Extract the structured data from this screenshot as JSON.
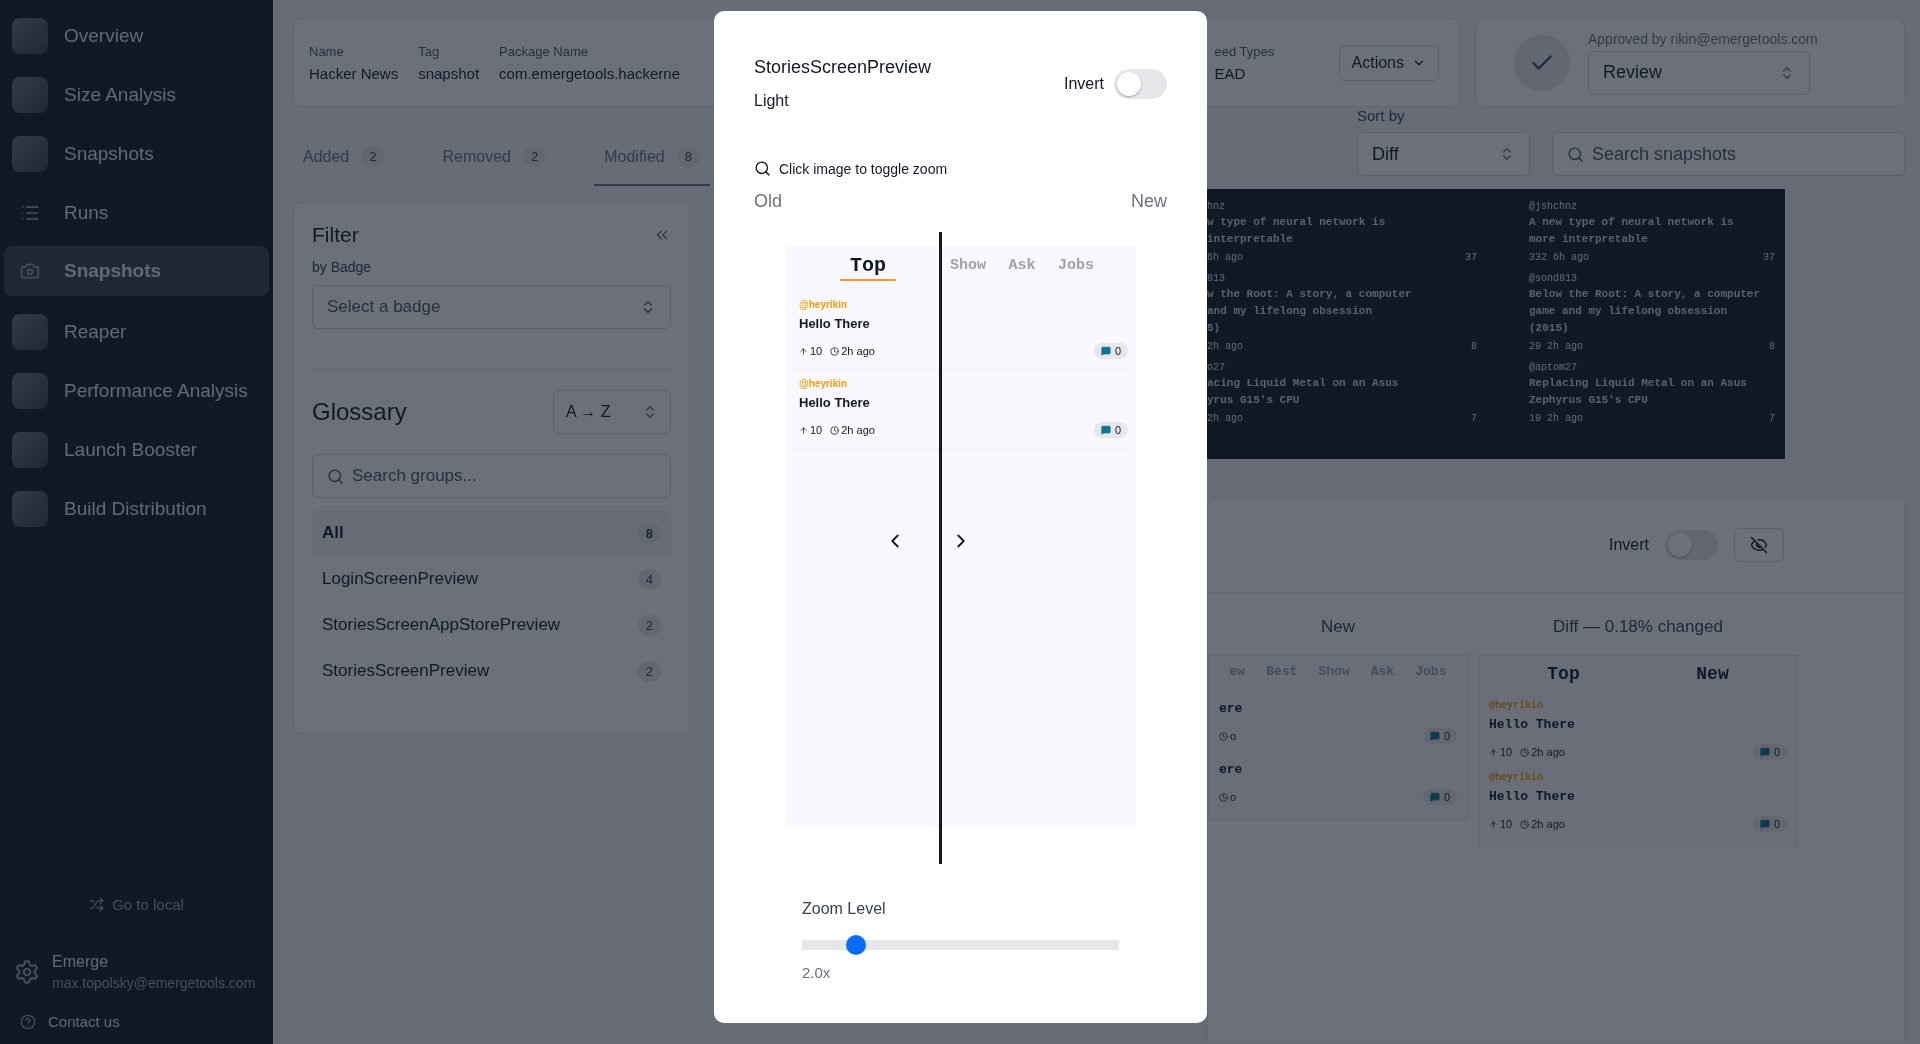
{
  "sidebar": {
    "items": [
      {
        "label": "Overview",
        "kind": "app",
        "selected": false
      },
      {
        "label": "Size Analysis",
        "kind": "app",
        "selected": false
      },
      {
        "label": "Snapshots",
        "kind": "app",
        "selected": false
      },
      {
        "label": "Runs",
        "kind": "list",
        "selected": false
      },
      {
        "label": "Snapshots",
        "kind": "camera",
        "selected": true
      },
      {
        "label": "Reaper",
        "kind": "app",
        "selected": false
      },
      {
        "label": "Performance Analysis",
        "kind": "app",
        "selected": false
      },
      {
        "label": "Launch Booster",
        "kind": "app",
        "selected": false
      },
      {
        "label": "Build Distribution",
        "kind": "app",
        "selected": false
      }
    ],
    "go_local": "Go to local",
    "account": {
      "name": "Emerge",
      "email": "max.topolsky@emergetools.com"
    },
    "contact": "Contact us"
  },
  "header": {
    "fields": [
      {
        "label": "Name",
        "value": "Hacker News"
      },
      {
        "label": "Tag",
        "value": "snapshot"
      },
      {
        "label": "Package Name",
        "value": "com.emergetools.hackerne"
      },
      {
        "label": "eed Types",
        "value": "EAD"
      }
    ],
    "actions": "Actions",
    "approval": {
      "text": "Approved by rikin@emergetools.com",
      "status": "Review"
    }
  },
  "tabs": [
    {
      "label": "Added",
      "count": "2",
      "selected": false
    },
    {
      "label": "Removed",
      "count": "2",
      "selected": false
    },
    {
      "label": "Modified",
      "count": "8",
      "selected": true
    }
  ],
  "sort": {
    "label": "Sort by",
    "value": "Diff"
  },
  "search": {
    "placeholder": "Search snapshots"
  },
  "filter": {
    "title": "Filter",
    "badge_label": "by Badge",
    "badge_placeholder": "Select a badge",
    "glossary": "Glossary",
    "order": "A → Z",
    "search_placeholder": "Search groups...",
    "groups": [
      {
        "name": "All",
        "count": "8",
        "selected": true
      },
      {
        "name": "LoginScreenPreview",
        "count": "4",
        "selected": false
      },
      {
        "name": "StoriesScreenAppStorePreview",
        "count": "2",
        "selected": false
      },
      {
        "name": "StoriesScreenPreview",
        "count": "2",
        "selected": false
      }
    ]
  },
  "dark_preview": {
    "columns": [
      {
        "stories": [
          {
            "author": "hnz",
            "lines": [
              "w type of neural network is",
              "interpretable"
            ],
            "time": "6h ago",
            "comments": "37"
          },
          {
            "author": "813",
            "lines": [
              "w the Root: A story, a computer",
              "and my lifelong obsession",
              "5)"
            ],
            "time": "2h ago",
            "comments": "8"
          },
          {
            "author": "o27",
            "lines": [
              "acing Liquid Metal on an Asus",
              "yrus G15's CPU"
            ],
            "time": "2h ago",
            "comments": "7"
          }
        ]
      },
      {
        "stories": [
          {
            "author": "@jshchnz",
            "lines": [
              "A new type of neural network is",
              "more interpretable"
            ],
            "points": "332",
            "time": "6h ago",
            "comments": "37"
          },
          {
            "author": "@sond813",
            "lines": [
              "Below the Root: A story, a computer",
              "game and my lifelong obsession",
              "(2015)"
            ],
            "points": "29",
            "time": "2h ago",
            "comments": "8"
          },
          {
            "author": "@aptom27",
            "lines": [
              "Replacing Liquid Metal on an Asus",
              "Zephyrus G15's CPU"
            ],
            "points": "19",
            "time": "2h ago",
            "comments": "7"
          }
        ]
      }
    ]
  },
  "compare": {
    "invert": {
      "label": "Invert",
      "on": false
    },
    "columns": [
      {
        "heading": "New",
        "tabs": [
          {
            "label": "ew",
            "selected": false
          },
          {
            "label": "Best",
            "selected": false
          },
          {
            "label": "Show",
            "selected": false
          },
          {
            "label": "Ask",
            "selected": false
          },
          {
            "label": "Jobs",
            "selected": false
          }
        ],
        "stories": [
          {
            "title": "ere",
            "time": "o",
            "comments": "0"
          },
          {
            "title": "ere",
            "time": "o",
            "comments": "0"
          }
        ]
      },
      {
        "heading": "Diff — 0.18% changed",
        "tabs": [
          {
            "label": "Top",
            "selected": true
          },
          {
            "label": "New",
            "selected": true
          }
        ],
        "stories": [
          {
            "author": "@heyrikin",
            "title": "Hello There",
            "points": "10",
            "time": "2h ago",
            "comments": "0"
          },
          {
            "author": "@heyrikin",
            "title": "Hello There",
            "points": "10",
            "time": "2h ago",
            "comments": "0"
          }
        ]
      }
    ]
  },
  "modal": {
    "title": "StoriesScreenPreview",
    "subtitle": "Light",
    "invert": {
      "label": "Invert",
      "on": false
    },
    "hint": "Click image to toggle zoom",
    "old_label": "Old",
    "new_label": "New",
    "tabs": [
      {
        "label": "Top",
        "selected": true
      },
      {
        "label": "Show",
        "selected": false
      },
      {
        "label": "Ask",
        "selected": false
      },
      {
        "label": "Jobs",
        "selected": false
      }
    ],
    "stories": [
      {
        "author": "@heyrikin",
        "title": "Hello There",
        "points": "10",
        "time": "2h ago",
        "comments": "0"
      },
      {
        "author": "@heyrikin",
        "title": "Hello There",
        "points": "10",
        "time": "2h ago",
        "comments": "0"
      }
    ],
    "zoom": {
      "label": "Zoom Level",
      "level": 0.17,
      "reading": "2.0x"
    }
  }
}
